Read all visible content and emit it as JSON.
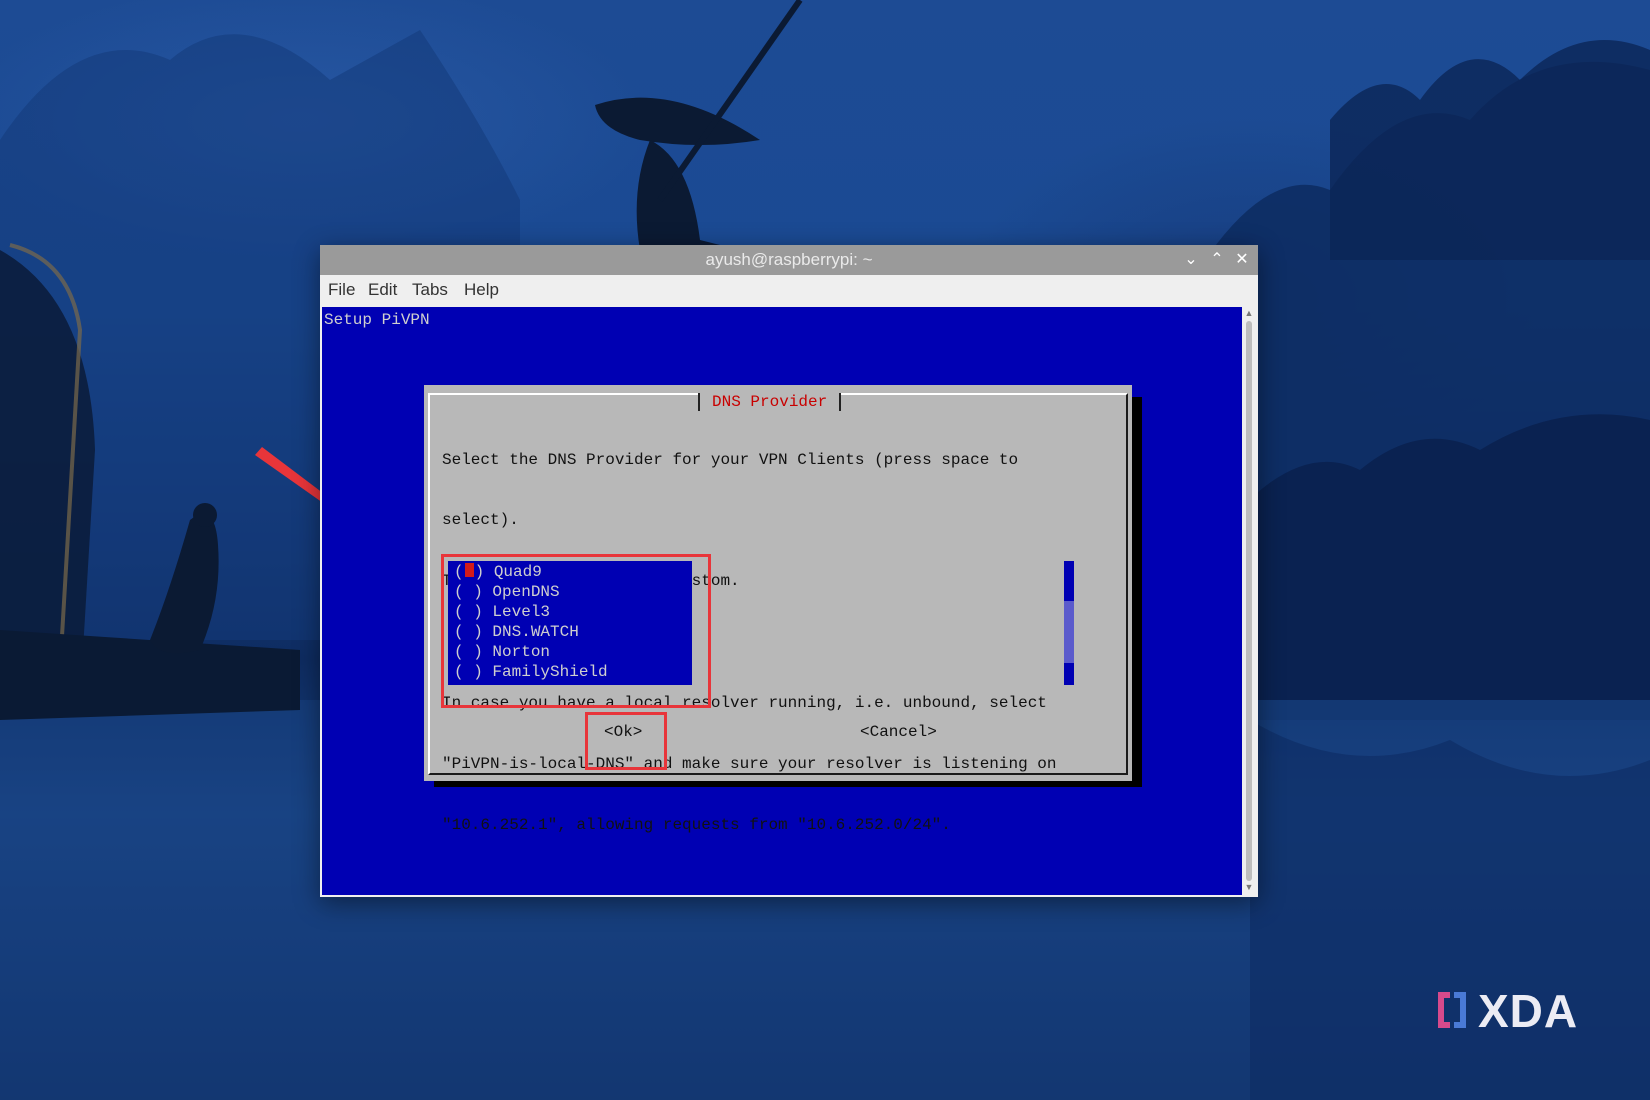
{
  "window": {
    "title": "ayush@raspberrypi: ~",
    "controls": [
      "minimize",
      "maximize",
      "close"
    ],
    "menu": [
      "File",
      "Edit",
      "Tabs",
      "Help"
    ]
  },
  "terminal": {
    "header": "Setup PiVPN",
    "dialog": {
      "title": "DNS Provider",
      "text_lines": [
        "Select the DNS Provider for your VPN Clients (press space to",
        "select).",
        "To use your own, select Custom.",
        "",
        "In case you have a local resolver running, i.e. unbound, select",
        "\"PiVPN-is-local-DNS\" and make sure your resolver is listening on",
        "\"10.6.252.1\", allowing requests from \"10.6.252.0/24\"."
      ],
      "options": [
        {
          "label": "Quad9",
          "selected": true
        },
        {
          "label": "OpenDNS",
          "selected": false
        },
        {
          "label": "Level3",
          "selected": false
        },
        {
          "label": "DNS.WATCH",
          "selected": false
        },
        {
          "label": "Norton",
          "selected": false
        },
        {
          "label": "FamilyShield",
          "selected": false
        }
      ],
      "ok_label": "<Ok>",
      "cancel_label": "<Cancel>"
    }
  },
  "watermark": "XDA",
  "colors": {
    "terminal_bg": "#0000b3",
    "dialog_bg": "#b8b8b8",
    "dialog_title": "#c80000",
    "annotation_red": "#e8353a"
  }
}
